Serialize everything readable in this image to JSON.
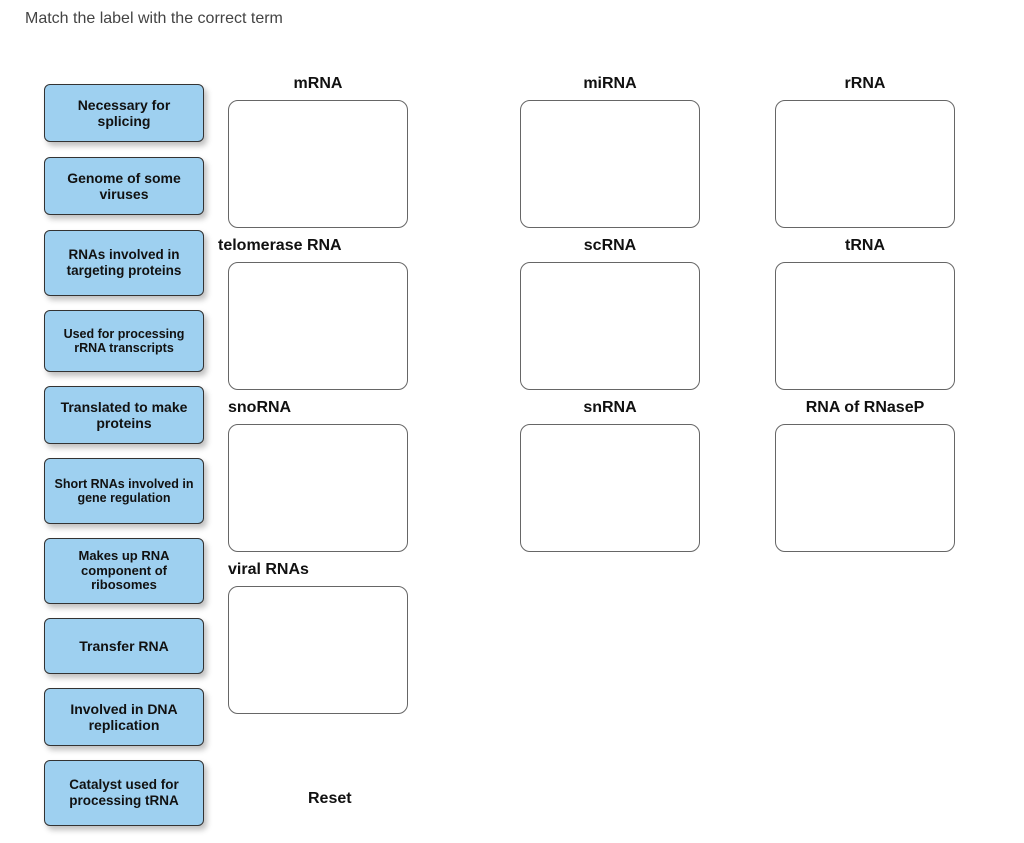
{
  "instruction": "Match the label with the correct term",
  "labels": [
    "Necessary for splicing",
    "Genome of some viruses",
    "RNAs involved in targeting proteins",
    "Used for processing rRNA transcripts",
    "Translated to make proteins",
    "Short RNAs involved in gene regulation",
    "Makes up RNA component of ribosomes",
    "Transfer RNA",
    "Involved in DNA replication",
    "Catalyst used for processing tRNA"
  ],
  "targets": {
    "col1": [
      "mRNA",
      "telomerase RNA",
      "snoRNA",
      "viral RNAs"
    ],
    "col2": [
      "miRNA",
      "scRNA",
      "snRNA"
    ],
    "col3": [
      "rRNA",
      "tRNA",
      "RNA of RNaseP"
    ]
  },
  "reset_label": "Reset"
}
